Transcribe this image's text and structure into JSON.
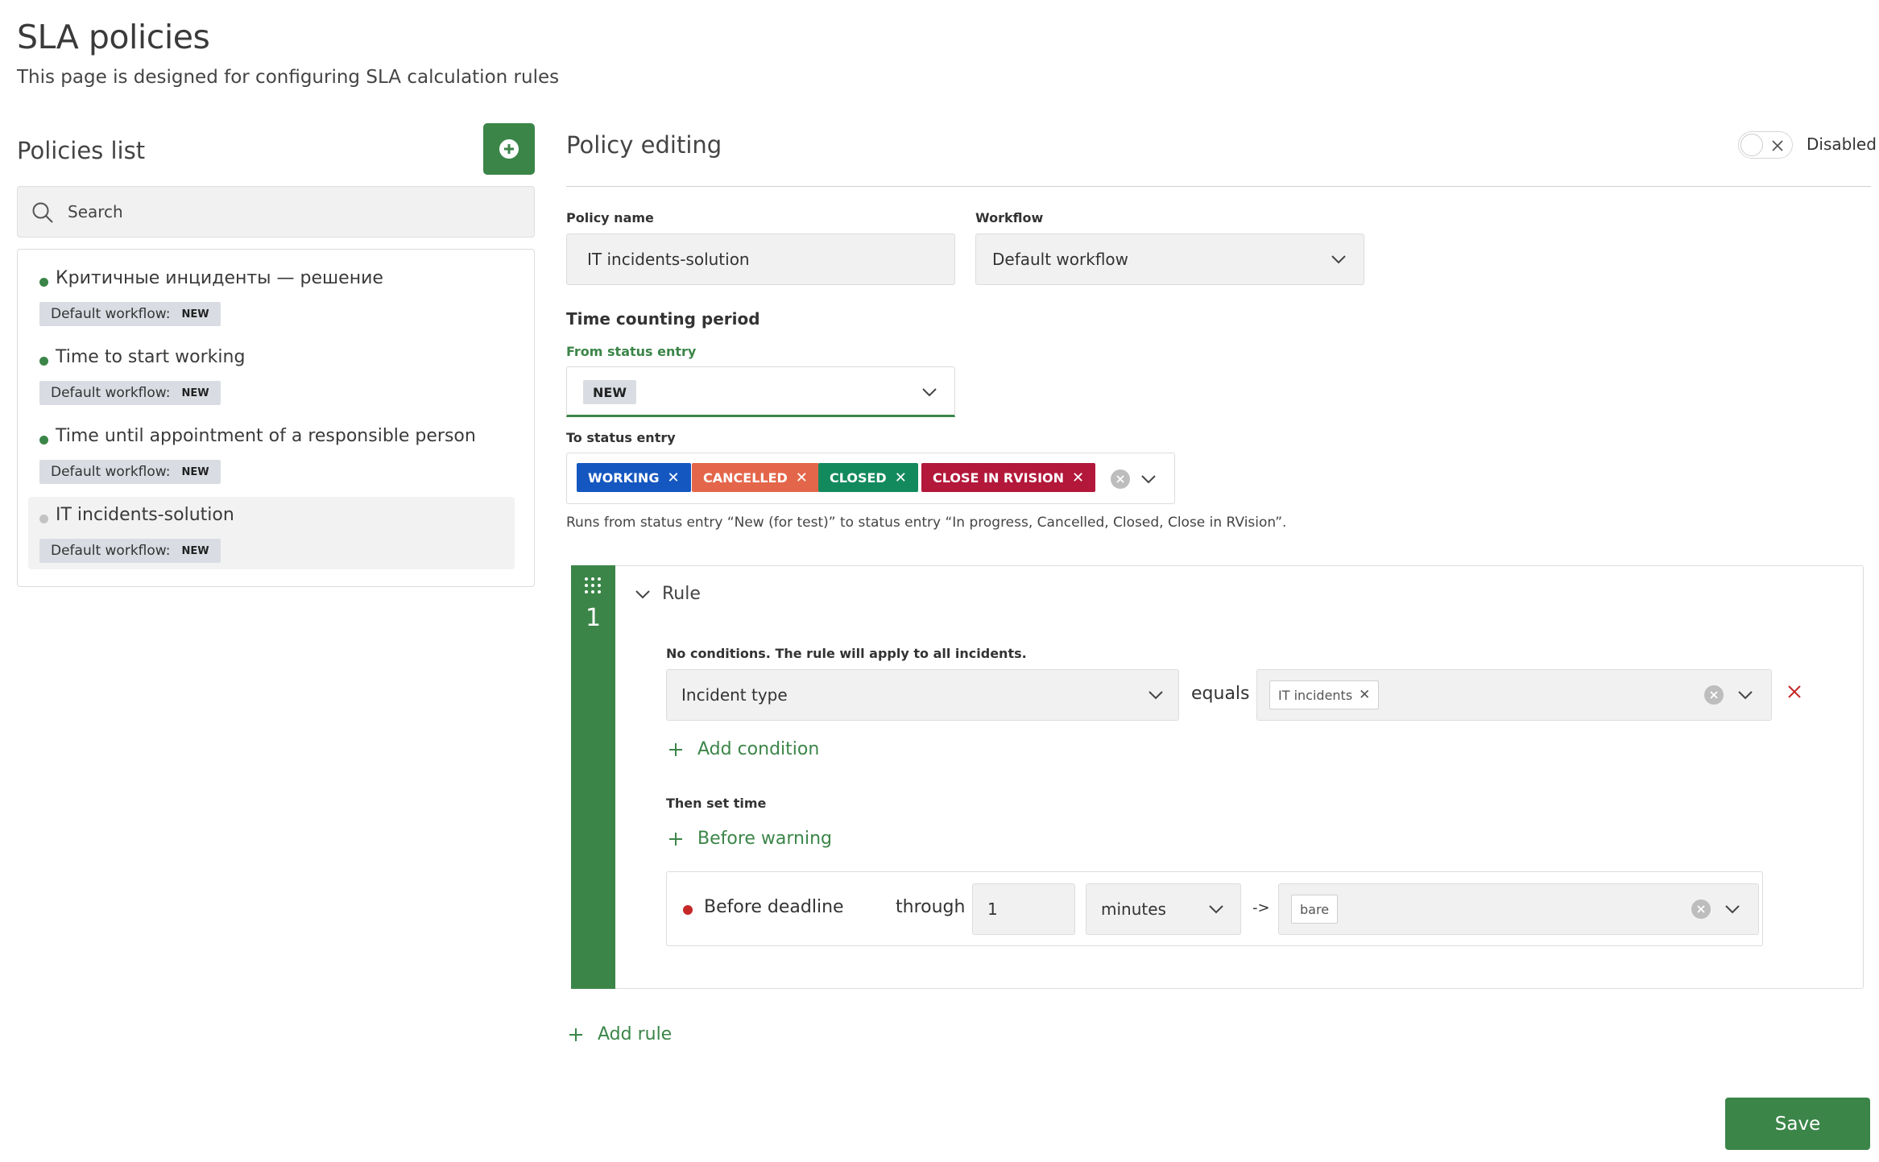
{
  "header": {
    "title": "SLA policies",
    "subtitle": "This page is designed for configuring SLA calculation rules"
  },
  "sidebar": {
    "title": "Policies list",
    "search_placeholder": "Search",
    "policies": [
      {
        "name": "Критичные инциденты — решение",
        "workflow": "Default workflow:",
        "status": "NEW",
        "active": true
      },
      {
        "name": "Time to start working",
        "workflow": "Default workflow:",
        "status": "NEW",
        "active": true
      },
      {
        "name": "Time until appointment of a responsible person",
        "workflow": "Default workflow:",
        "status": "NEW",
        "active": true
      },
      {
        "name": "IT incidents-solution",
        "workflow": "Default workflow:",
        "status": "NEW",
        "active": false,
        "selected": true
      }
    ]
  },
  "editor": {
    "title": "Policy editing",
    "toggle_label": "Disabled",
    "policy_name_label": "Policy name",
    "policy_name_value": "IT incidents-solution",
    "workflow_label": "Workflow",
    "workflow_value": "Default workflow",
    "period_title": "Time counting period",
    "from_label": "From status entry",
    "from_value": "NEW",
    "to_label": "To status entry",
    "to_tags": [
      {
        "label": "WORKING",
        "color": "#1557c0"
      },
      {
        "label": "CANCELLED",
        "color": "#e4664a"
      },
      {
        "label": "CLOSED",
        "color": "#138a5e"
      },
      {
        "label": "CLOSE IN RVISION",
        "color": "#b3173a"
      }
    ],
    "hint": "Runs from status entry “New (for test)” to status entry “In progress, Cancelled, Closed, Close in RVision”."
  },
  "rule": {
    "number": "1",
    "title": "Rule",
    "no_conditions": "No conditions. The rule will apply to all incidents.",
    "condition_field": "Incident type",
    "operator": "equals",
    "condition_value": "IT incidents",
    "add_condition": "Add condition",
    "then_label": "Then set time",
    "before_warning": "Before warning",
    "deadline_label": "Before deadline",
    "through": "through",
    "amount": "1",
    "unit": "minutes",
    "arrow": "->",
    "target_value": "bare"
  },
  "actions": {
    "add_rule": "Add rule",
    "save": "Save"
  },
  "colors": {
    "accent_green": "#3b8548",
    "danger_red": "#c62828"
  }
}
